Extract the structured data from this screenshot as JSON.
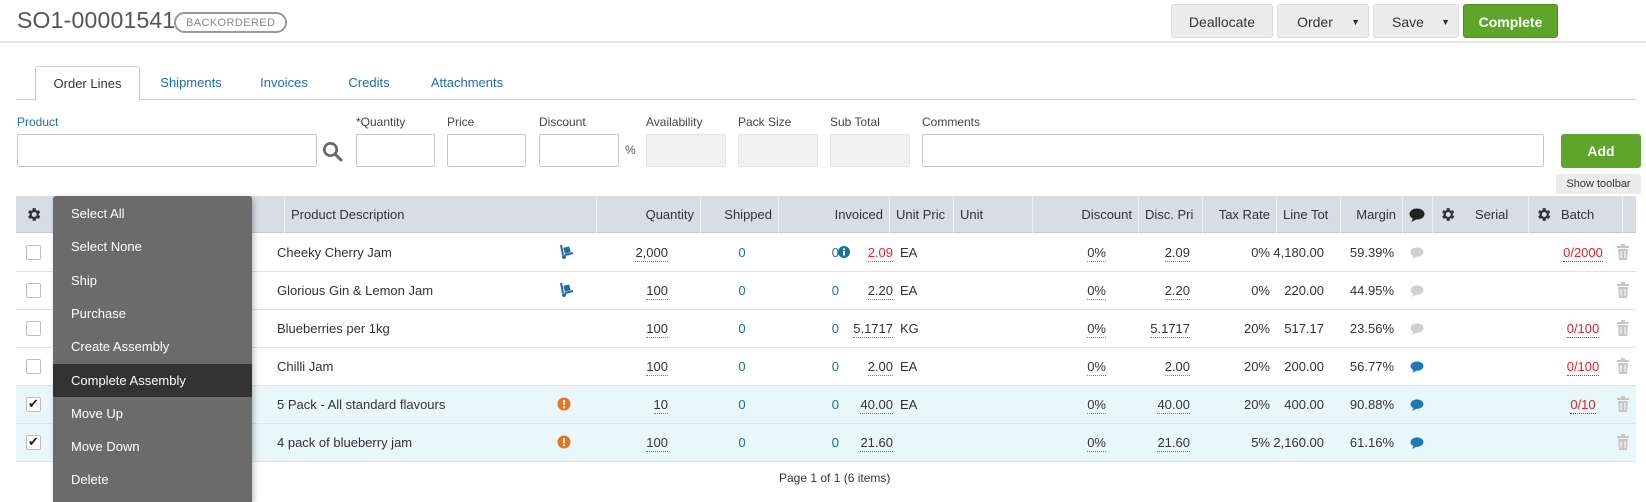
{
  "header": {
    "order_number": "SO1-00001541",
    "status": "BACKORDERED",
    "buttons": {
      "deallocate": "Deallocate",
      "order": "Order",
      "save": "Save",
      "complete": "Complete"
    },
    "colors": {
      "complete": "#5ea52b"
    }
  },
  "tabs": [
    "Order Lines",
    "Shipments",
    "Invoices",
    "Credits",
    "Attachments"
  ],
  "entry": {
    "labels": {
      "product": "Product",
      "quantity": "*Quantity",
      "price": "Price",
      "discount": "Discount",
      "percent": "%",
      "availability": "Availability",
      "pack_size": "Pack Size",
      "sub_total": "Sub Total",
      "comments": "Comments"
    },
    "add": "Add",
    "show_toolbar": "Show toolbar"
  },
  "grid": {
    "headers": {
      "description": "Product Description",
      "quantity": "Quantity",
      "shipped": "Shipped",
      "invoiced": "Invoiced",
      "unit_price": "Unit Pric",
      "unit": "Unit",
      "discount": "Discount",
      "disc_price": "Disc. Pri",
      "tax_rate": "Tax Rate",
      "line_total": "Line Tot",
      "margin": "Margin",
      "serial": "Serial",
      "batch": "Batch"
    },
    "rows": [
      {
        "checked": false,
        "description": "Cheeky Cherry Jam",
        "status_icon": "hand-truck-icon",
        "quantity": "2,000",
        "shipped": "0",
        "invoiced": "0",
        "info_icon": true,
        "unit_price": "2.09",
        "price_red": true,
        "unit": "EA",
        "discount": "0%",
        "disc_price": "2.09",
        "tax_rate": "0%",
        "line_total": "4,180.00",
        "margin": "59.39%",
        "comment_active": false,
        "batch": "0/2000"
      },
      {
        "checked": false,
        "description": "Glorious Gin & Lemon Jam",
        "status_icon": "hand-truck-icon",
        "quantity": "100",
        "shipped": "0",
        "invoiced": "0",
        "info_icon": false,
        "unit_price": "2.20",
        "price_red": false,
        "unit": "EA",
        "discount": "0%",
        "disc_price": "2.20",
        "tax_rate": "0%",
        "line_total": "220.00",
        "margin": "44.95%",
        "comment_active": false,
        "batch": ""
      },
      {
        "checked": false,
        "description": "Blueberries per 1kg",
        "status_icon": "",
        "quantity": "100",
        "shipped": "0",
        "invoiced": "0",
        "info_icon": false,
        "unit_price": "5.1717",
        "price_red": false,
        "unit": "KG",
        "discount": "0%",
        "disc_price": "5.1717",
        "tax_rate": "20%",
        "line_total": "517.17",
        "margin": "23.56%",
        "comment_active": false,
        "batch": "0/100"
      },
      {
        "checked": false,
        "description": "Chilli Jam",
        "status_icon": "",
        "quantity": "100",
        "shipped": "0",
        "invoiced": "0",
        "info_icon": false,
        "unit_price": "2.00",
        "price_red": false,
        "unit": "EA",
        "discount": "0%",
        "disc_price": "2.00",
        "tax_rate": "20%",
        "line_total": "200.00",
        "margin": "56.77%",
        "comment_active": true,
        "batch": "0/100"
      },
      {
        "checked": true,
        "description": "5 Pack - All standard flavours",
        "status_icon": "warning-icon",
        "quantity": "10",
        "shipped": "0",
        "invoiced": "0",
        "info_icon": false,
        "unit_price": "40.00",
        "price_red": false,
        "unit": "EA",
        "discount": "0%",
        "disc_price": "40.00",
        "tax_rate": "20%",
        "line_total": "400.00",
        "margin": "90.88%",
        "comment_active": true,
        "batch": "0/10"
      },
      {
        "checked": true,
        "description": "4 pack of blueberry jam",
        "status_icon": "warning-icon",
        "quantity": "100",
        "shipped": "0",
        "invoiced": "0",
        "info_icon": false,
        "unit_price": "21.60",
        "price_red": false,
        "unit": "",
        "discount": "0%",
        "disc_price": "21.60",
        "tax_rate": "5%",
        "line_total": "2,160.00",
        "margin": "61.16%",
        "comment_active": true,
        "batch": ""
      }
    ],
    "pager": "Page 1 of 1 (6 items)"
  },
  "context_menu": {
    "items": [
      "Select All",
      "Select None",
      "Ship",
      "Purchase",
      "Create Assembly",
      "Complete Assembly",
      "Move Up",
      "Move Down",
      "Delete"
    ],
    "highlighted": "Complete Assembly"
  }
}
